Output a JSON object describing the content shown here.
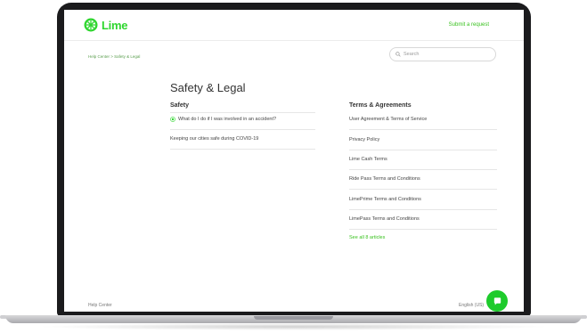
{
  "header": {
    "logo_text": "Lime",
    "submit_label": "Submit a request"
  },
  "subbar": {
    "breadcrumb": "Help Center  >  Safety & Legal",
    "search_placeholder": "Search"
  },
  "main": {
    "title": "Safety & Legal",
    "safety": {
      "heading": "Safety",
      "items": [
        "What do I do if I was involved in an accident?",
        "Keeping our cities safe during COVID-19"
      ]
    },
    "terms": {
      "heading": "Terms & Agreements",
      "items": [
        "User Agreement & Terms of Service",
        "Privacy Policy",
        "Lime Cash Terms",
        "Ride Pass Terms and Conditions",
        "LimePrime Terms and Conditions",
        "LimePass Terms and Conditions"
      ],
      "see_all": "See all 8 articles"
    }
  },
  "footer": {
    "left": "Help Center",
    "right": "English (US)"
  },
  "colors": {
    "brand_green": "#2fd62f",
    "chat_green": "#1ecb2c"
  }
}
